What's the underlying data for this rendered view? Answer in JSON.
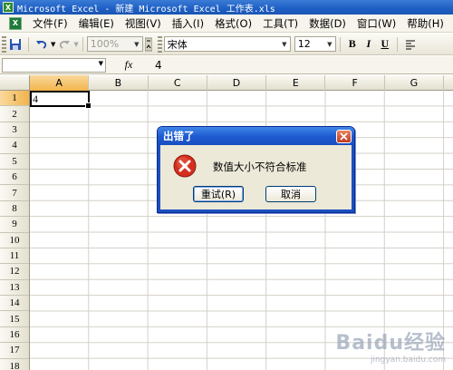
{
  "window": {
    "title": "Microsoft Excel - 新建 Microsoft Excel 工作表.xls"
  },
  "menu": {
    "items": [
      "文件(F)",
      "编辑(E)",
      "视图(V)",
      "插入(I)",
      "格式(O)",
      "工具(T)",
      "数据(D)",
      "窗口(W)",
      "帮助(H)"
    ]
  },
  "toolbar": {
    "zoom": "100%",
    "font_name": "宋体",
    "font_size": "12",
    "bold_label": "B",
    "italic_label": "I",
    "underline_label": "U"
  },
  "formula_bar": {
    "name_box": "",
    "fx_label": "fx",
    "value": "4"
  },
  "sheet": {
    "columns": [
      "A",
      "B",
      "C",
      "D",
      "E",
      "F",
      "G"
    ],
    "rows": [
      "1",
      "2",
      "3",
      "4",
      "5",
      "6",
      "7",
      "8",
      "9",
      "10",
      "11",
      "12",
      "13",
      "14",
      "15",
      "16",
      "17",
      "18"
    ],
    "active_column": "A",
    "active_row": "1",
    "cell_a1": "4"
  },
  "dialog": {
    "title": "出错了",
    "message": "数值大小不符合标准",
    "retry_label": "重试(R)",
    "cancel_label": "取消",
    "icon": "error-icon"
  },
  "watermark": {
    "brand": "Baidu经验",
    "url": "jingyan.baidu.com"
  },
  "colors": {
    "title_bar": "#1e5fc4",
    "active_header": "#f2b44d",
    "error_red": "#d42e1e"
  }
}
